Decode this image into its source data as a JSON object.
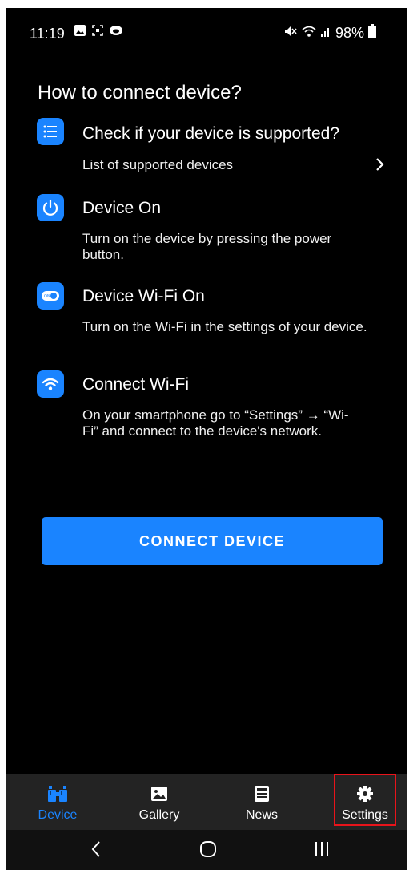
{
  "status_bar": {
    "time": "11:19",
    "battery": "98%"
  },
  "page": {
    "title": "How to connect device?"
  },
  "steps": [
    {
      "icon": "list-icon",
      "title": "Check if your device is supported?",
      "link_label": "List of supported devices"
    },
    {
      "icon": "power-icon",
      "title": "Device On",
      "description": "Turn on the device by pressing the power button."
    },
    {
      "icon": "toggle-icon",
      "title": "Device Wi-Fi On",
      "description": "Turn on the Wi-Fi in the settings of your device."
    },
    {
      "icon": "wifi-icon",
      "title": "Connect Wi-Fi",
      "description": "On your smartphone go to “Settings” → “Wi-Fi” and connect to the device's network."
    }
  ],
  "connect_button": {
    "label": "CONNECT DEVICE"
  },
  "bottom_nav": {
    "items": [
      {
        "label": "Device",
        "icon": "binoculars-icon",
        "active": true
      },
      {
        "label": "Gallery",
        "icon": "image-icon",
        "active": false
      },
      {
        "label": "News",
        "icon": "newspaper-icon",
        "active": false
      },
      {
        "label": "Settings",
        "icon": "gear-icon",
        "active": false
      }
    ]
  },
  "colors": {
    "accent": "#1a84ff",
    "background": "#000000",
    "nav_background": "#232323",
    "highlight": "#e8141b"
  }
}
